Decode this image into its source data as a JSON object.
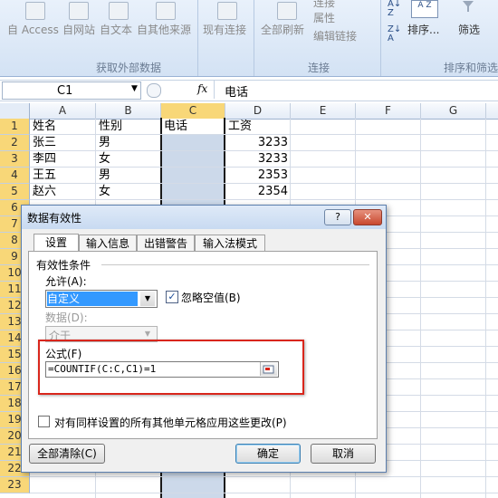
{
  "ribbon": {
    "buttons": [
      "自 Access",
      "自网站",
      "自文本",
      "自其他来源",
      "现有连接",
      "全部刷新"
    ],
    "connections_items": [
      "连接",
      "属性",
      "编辑链接"
    ],
    "sort_label": "排序...",
    "filter_label": "筛选",
    "groups": [
      "获取外部数据",
      "连接",
      "排序和筛选"
    ]
  },
  "formula_bar": {
    "name_box": "C1",
    "fx": "fx",
    "value": "电话"
  },
  "grid": {
    "columns": [
      "A",
      "B",
      "C",
      "D",
      "E",
      "F",
      "G"
    ],
    "rows": [
      "1",
      "2",
      "3",
      "4",
      "5",
      "6",
      "7",
      "8",
      "9",
      "10",
      "11",
      "12",
      "13",
      "14",
      "15",
      "16",
      "17",
      "18",
      "19",
      "20",
      "21",
      "22",
      "23"
    ],
    "headers": [
      "姓名",
      "性别",
      "电话",
      "工资"
    ],
    "data": [
      [
        "张三",
        "男",
        "",
        "3233"
      ],
      [
        "李四",
        "女",
        "",
        "3233"
      ],
      [
        "王五",
        "男",
        "",
        "2353"
      ],
      [
        "赵六",
        "女",
        "",
        "2354"
      ]
    ]
  },
  "dialog": {
    "title": "数据有效性",
    "help": "?",
    "close": "✕",
    "tabs": [
      "设置",
      "输入信息",
      "出错警告",
      "输入法模式"
    ],
    "section": "有效性条件",
    "allow_label": "允许(A):",
    "allow_value": "自定义",
    "ignore_blank": "忽略空值(B)",
    "data_label": "数据(D):",
    "data_value": "介于",
    "formula_label": "公式(F)",
    "formula_value": "=COUNTIF(C:C,C1)=1",
    "apply_all": "对有同样设置的所有其他单元格应用这些更改(P)",
    "clear_all": "全部清除(C)",
    "ok": "确定",
    "cancel": "取消"
  },
  "colors": {
    "highlight_red": "#d9261c",
    "selected_col": "#ccd9ea",
    "row_header_selected": "#f8d778"
  }
}
